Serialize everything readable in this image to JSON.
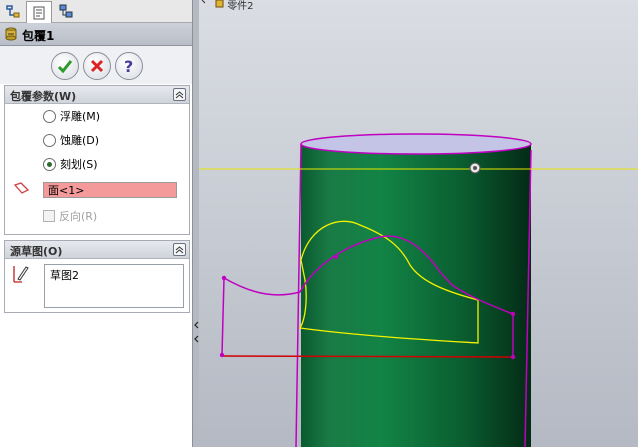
{
  "feature": {
    "title": "包覆1"
  },
  "tabs": [
    {
      "icon": "feature-manager-icon"
    },
    {
      "icon": "property-manager-icon"
    },
    {
      "icon": "configuration-manager-icon"
    }
  ],
  "actions": {
    "ok": "ok-icon",
    "cancel": "cancel-icon",
    "help": "help-icon"
  },
  "params": {
    "title": "包覆参数(W)",
    "options": [
      {
        "label": "浮雕(M)",
        "selected": false
      },
      {
        "label": "蚀雕(D)",
        "selected": false
      },
      {
        "label": "刻划(S)",
        "selected": true
      }
    ],
    "face_field": "面<1>",
    "reverse_label": "反向(R)"
  },
  "source_sketch": {
    "title": "源草图(O)",
    "items": [
      "草图2"
    ]
  },
  "breadcrumb": "零件2",
  "colors": {
    "cylinder": "#0c6a39",
    "highlight": "#c800c8",
    "sketch": "#f2f200",
    "selection": "#f49a9a"
  }
}
